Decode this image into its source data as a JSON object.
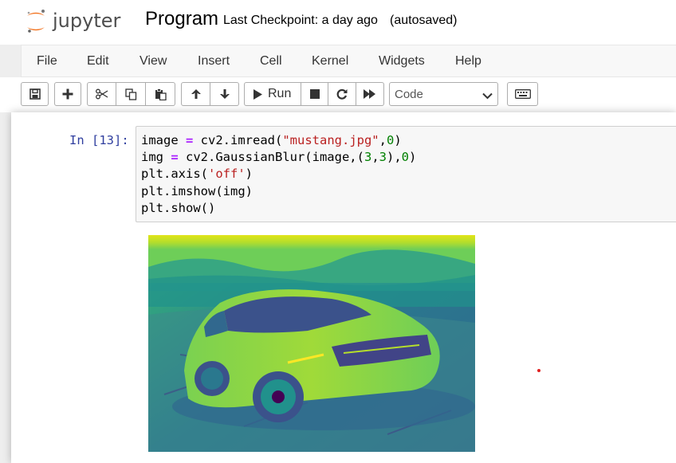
{
  "header": {
    "logo_text": "jupyter",
    "notebook_name": "Program",
    "checkpoint": "Last Checkpoint: a day ago",
    "autosave": "(autosaved)"
  },
  "menu": {
    "items": [
      "File",
      "Edit",
      "View",
      "Insert",
      "Cell",
      "Kernel",
      "Widgets",
      "Help"
    ]
  },
  "toolbar": {
    "run_label": "Run",
    "cell_type": "Code",
    "icons": [
      "save-icon",
      "plus-icon",
      "scissors-icon",
      "copy-icon",
      "paste-icon",
      "arrow-up-icon",
      "arrow-down-icon",
      "play-icon",
      "stop-icon",
      "restart-icon",
      "fast-forward-icon",
      "keyboard-icon"
    ]
  },
  "cell": {
    "prompt": "In [13]:",
    "lines": [
      {
        "a": "image",
        "op": " = ",
        "b": "cv2.imread(",
        "s": "\"mustang.jpg\"",
        "c": ",",
        "n": "0",
        "d": ")"
      },
      {
        "a": "img",
        "op": " = ",
        "b": "cv2.GaussianBlur(image,(",
        "n1": "3",
        "c1": ",",
        "n2": "3",
        "c2": "),",
        "n3": "0",
        "d": ")"
      },
      {
        "a": "plt.axis(",
        "s": "'off'",
        "d": ")"
      },
      {
        "a": "plt.imshow(img)"
      },
      {
        "a": "plt.show()"
      }
    ]
  },
  "colors": {
    "prompt": "#303f9f",
    "string": "#ba2121",
    "number": "#008000",
    "operator": "#aa22ff",
    "logo_orange": "#f37726"
  }
}
